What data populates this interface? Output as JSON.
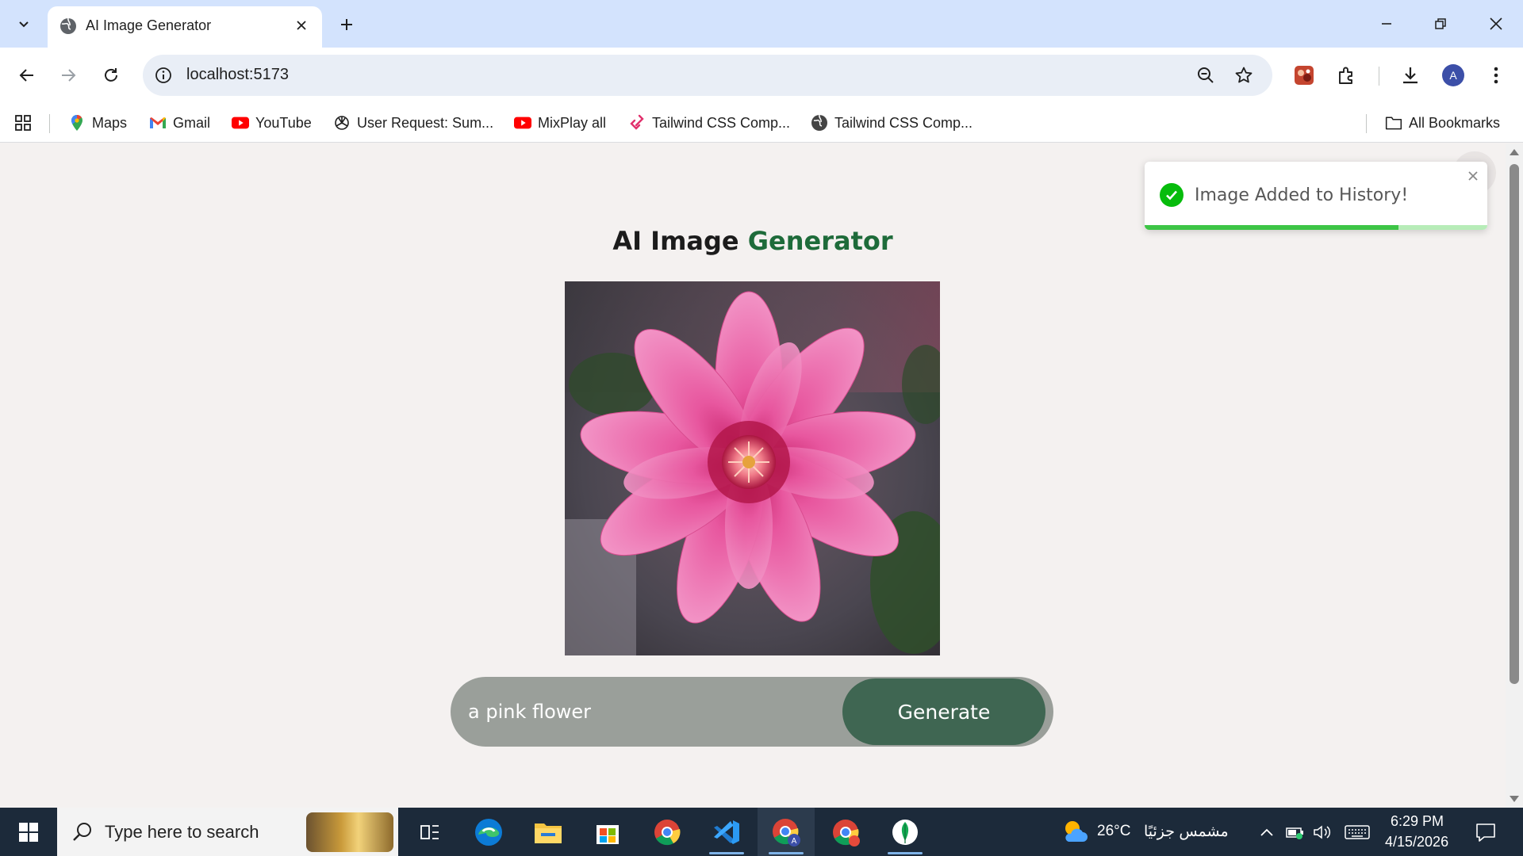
{
  "browser": {
    "tab_title": "AI Image Generator",
    "url": "localhost:5173",
    "profile_initial": "A"
  },
  "bookmarks": {
    "items": [
      {
        "label": "Maps",
        "icon": "maps-pin-icon"
      },
      {
        "label": "Gmail",
        "icon": "gmail-icon"
      },
      {
        "label": "YouTube",
        "icon": "youtube-icon"
      },
      {
        "label": "User Request: Sum...",
        "icon": "openai-icon"
      },
      {
        "label": "MixPlay all",
        "icon": "youtube-icon"
      },
      {
        "label": "Tailwind CSS Comp...",
        "icon": "tailwind-icon"
      },
      {
        "label": "Tailwind CSS Comp...",
        "icon": "globe-icon"
      }
    ],
    "all_bookmarks": "All Bookmarks"
  },
  "page": {
    "heading_plain": "AI Image",
    "heading_accent": "Generator",
    "prompt_value": "a pink flower",
    "generate_label": "Generate"
  },
  "toast": {
    "message": "Image Added to History!",
    "progress_fraction": 0.74
  },
  "taskbar": {
    "search_placeholder": "Type here to search",
    "weather_temp": "26°C",
    "weather_desc": "مشمس جزئيًا",
    "time": "6:29 PM",
    "date": "4/15/2026"
  },
  "colors": {
    "accent_green": "#1e6b3a",
    "generate_button": "#3f6652",
    "toast_success": "#07bc0c"
  }
}
